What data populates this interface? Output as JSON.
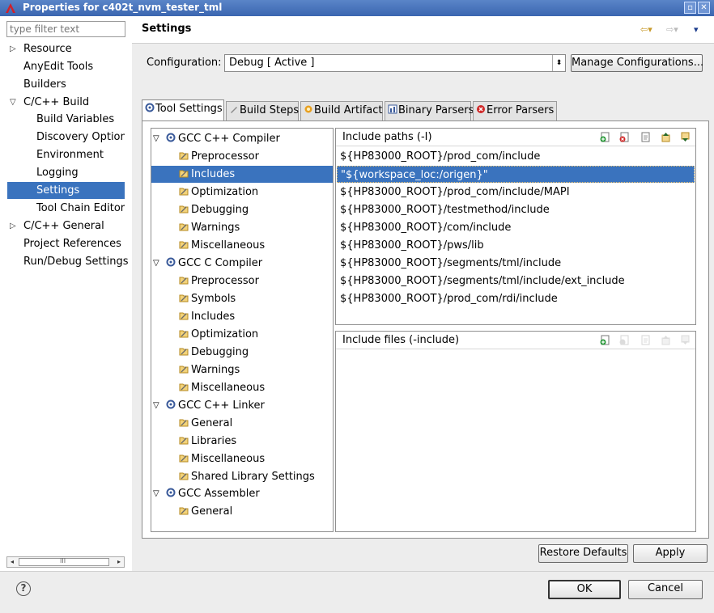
{
  "window": {
    "title": "Properties for c402t_nvm_tester_tml",
    "controls": [
      "▫",
      "✕"
    ]
  },
  "filter": {
    "placeholder": "type filter text"
  },
  "nav": {
    "items": [
      {
        "label": "Resource",
        "expander": "▷"
      },
      {
        "label": "AnyEdit Tools"
      },
      {
        "label": "Builders"
      },
      {
        "label": "C/C++ Build",
        "expander": "▽"
      },
      {
        "label": "Build Variables"
      },
      {
        "label": "Discovery Options"
      },
      {
        "label": "Environment"
      },
      {
        "label": "Logging"
      },
      {
        "label": "Settings"
      },
      {
        "label": "Tool Chain Editor"
      },
      {
        "label": "C/C++ General",
        "expander": "▷"
      },
      {
        "label": "Project References"
      },
      {
        "label": "Run/Debug Settings"
      }
    ],
    "scrollbar": {
      "left_arrow": "◂",
      "right_arrow": "▸",
      "grip": "III"
    }
  },
  "page": {
    "title": "Settings",
    "back_icon": "⇦▾",
    "forward_icon": "⇨▾",
    "menu_icon": "▾"
  },
  "configuration": {
    "label": "Configuration:",
    "value": "Debug  [ Active ]",
    "dropdown_glyph": "⬍",
    "manage_label": "Manage Configurations..."
  },
  "tabs": [
    {
      "label": "Tool Settings",
      "icon": "tool-settings-icon"
    },
    {
      "label": "Build Steps",
      "icon": "build-steps-icon"
    },
    {
      "label": "Build Artifact",
      "icon": "build-artifact-icon"
    },
    {
      "label": "Binary Parsers",
      "icon": "binary-parsers-icon"
    },
    {
      "label": "Error Parsers",
      "icon": "error-parsers-icon"
    }
  ],
  "tool_tree": {
    "expander": "▽",
    "groups": [
      {
        "label": "GCC C++ Compiler",
        "children": [
          "Preprocessor",
          "Includes",
          "Optimization",
          "Debugging",
          "Warnings",
          "Miscellaneous"
        ]
      },
      {
        "label": "GCC C Compiler",
        "children": [
          "Preprocessor",
          "Symbols",
          "Includes",
          "Optimization",
          "Debugging",
          "Warnings",
          "Miscellaneous"
        ]
      },
      {
        "label": "GCC C++ Linker",
        "children": [
          "General",
          "Libraries",
          "Miscellaneous",
          "Shared Library Settings"
        ]
      },
      {
        "label": "GCC Assembler",
        "children": [
          "General"
        ]
      }
    ]
  },
  "include_paths": {
    "header": "Include paths (-I)",
    "items": [
      "${HP83000_ROOT}/prod_com/include",
      "\"${workspace_loc:/origen}\"",
      "${HP83000_ROOT}/prod_com/include/MAPI",
      "${HP83000_ROOT}/testmethod/include",
      "${HP83000_ROOT}/com/include",
      "${HP83000_ROOT}/pws/lib",
      "${HP83000_ROOT}/segments/tml/include",
      "${HP83000_ROOT}/segments/tml/include/ext_include",
      "${HP83000_ROOT}/prod_com/rdi/include"
    ]
  },
  "include_files": {
    "header": "Include files (-include)",
    "items": []
  },
  "buttons": {
    "restore_defaults": "Restore Defaults",
    "apply": "Apply",
    "ok": "OK",
    "cancel": "Cancel",
    "help": "?"
  },
  "colors": {
    "selection": "#3a73be",
    "title_bar": "#3b66b0"
  }
}
